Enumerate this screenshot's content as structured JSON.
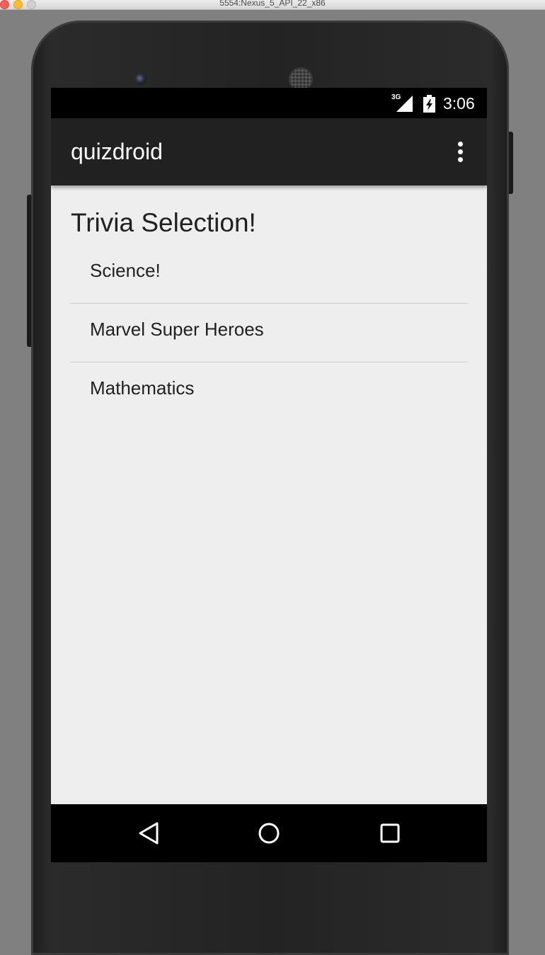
{
  "window": {
    "title": "5554:Nexus_5_API_22_x86"
  },
  "status_bar": {
    "network": "3G",
    "time": "3:06",
    "icons": [
      "signal-icon",
      "battery-charging-icon"
    ]
  },
  "app_bar": {
    "title": "quizdroid",
    "overflow_icon": "more-vert-icon"
  },
  "main": {
    "heading": "Trivia Selection!",
    "topics": [
      {
        "label": "Science!"
      },
      {
        "label": "Marvel Super Heroes"
      },
      {
        "label": "Mathematics"
      }
    ]
  },
  "nav_bar": {
    "icons": [
      "back-icon",
      "home-icon",
      "recents-icon"
    ]
  },
  "colors": {
    "app_bar": "#212121",
    "content_background": "#eeeeee",
    "divider": "#cfcfcf",
    "text": "#212121"
  }
}
